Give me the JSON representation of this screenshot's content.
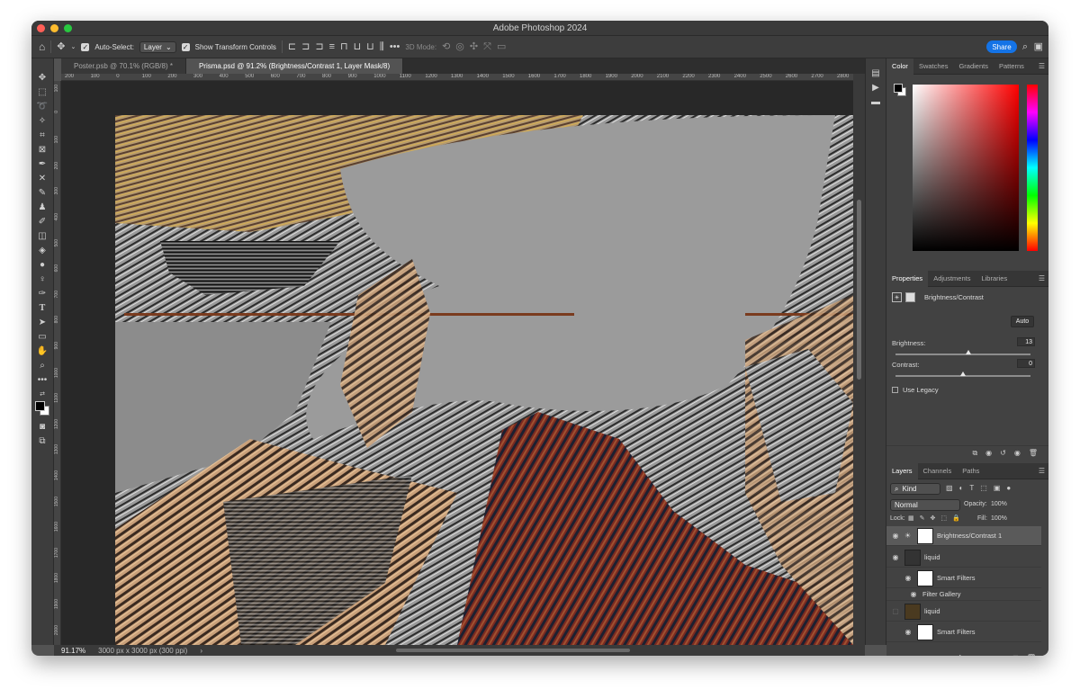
{
  "app": {
    "title": "Adobe Photoshop 2024"
  },
  "options": {
    "auto_select_label": "Auto-Select:",
    "layer_select": "Layer",
    "show_transform_label": "Show Transform Controls",
    "mode_3d_label": "3D Mode:",
    "share_label": "Share"
  },
  "tabs": [
    {
      "label": "Poster.psb @ 70.1% (RGB/8) *"
    },
    {
      "label": "Prisma.psd @ 91.2% (Brightness/Contrast 1, Layer Mask/8)"
    }
  ],
  "ruler": {
    "top": [
      "200",
      "100",
      "0",
      "100",
      "200",
      "300",
      "400",
      "500",
      "600",
      "700",
      "800",
      "900",
      "1000",
      "1100",
      "1200",
      "1300",
      "1400",
      "1500",
      "1600",
      "1700",
      "1800",
      "1900",
      "2000",
      "2100",
      "2200",
      "2300",
      "2400",
      "2500",
      "2600",
      "2700",
      "2800"
    ],
    "left": [
      "100",
      "0",
      "100",
      "200",
      "300",
      "400",
      "500",
      "600",
      "700",
      "800",
      "900",
      "1000",
      "1100",
      "1200",
      "1300",
      "1400",
      "1500",
      "1600",
      "1700",
      "1800",
      "1900",
      "2000"
    ]
  },
  "status": {
    "zoom": "91.17%",
    "doc_size": "3000 px x 3000 px (300 ppi)"
  },
  "color_panel": {
    "tabs": [
      "Color",
      "Swatches",
      "Gradients",
      "Patterns"
    ],
    "active": 0
  },
  "properties": {
    "tabs": [
      "Properties",
      "Adjustments",
      "Libraries"
    ],
    "adjustment_name": "Brightness/Contrast",
    "auto_label": "Auto",
    "brightness_label": "Brightness:",
    "brightness_value": "13",
    "contrast_label": "Contrast:",
    "contrast_value": "0",
    "legacy_label": "Use Legacy"
  },
  "layers": {
    "tabs": [
      "Layers",
      "Channels",
      "Paths"
    ],
    "filter_kind": "Kind",
    "blend_mode": "Normal",
    "opacity_label": "Opacity:",
    "opacity_value": "100%",
    "lock_label": "Lock:",
    "fill_label": "Fill:",
    "fill_value": "100%",
    "items": [
      {
        "name": "Brightness/Contrast 1"
      },
      {
        "name": "liquid"
      },
      {
        "name": "Smart Filters"
      },
      {
        "name": "Filter Gallery"
      },
      {
        "name": "liquid"
      },
      {
        "name": "Smart Filters"
      }
    ]
  },
  "colors": {
    "accent": "#1473e6",
    "fg": "#000000",
    "bg": "#ffffff"
  }
}
